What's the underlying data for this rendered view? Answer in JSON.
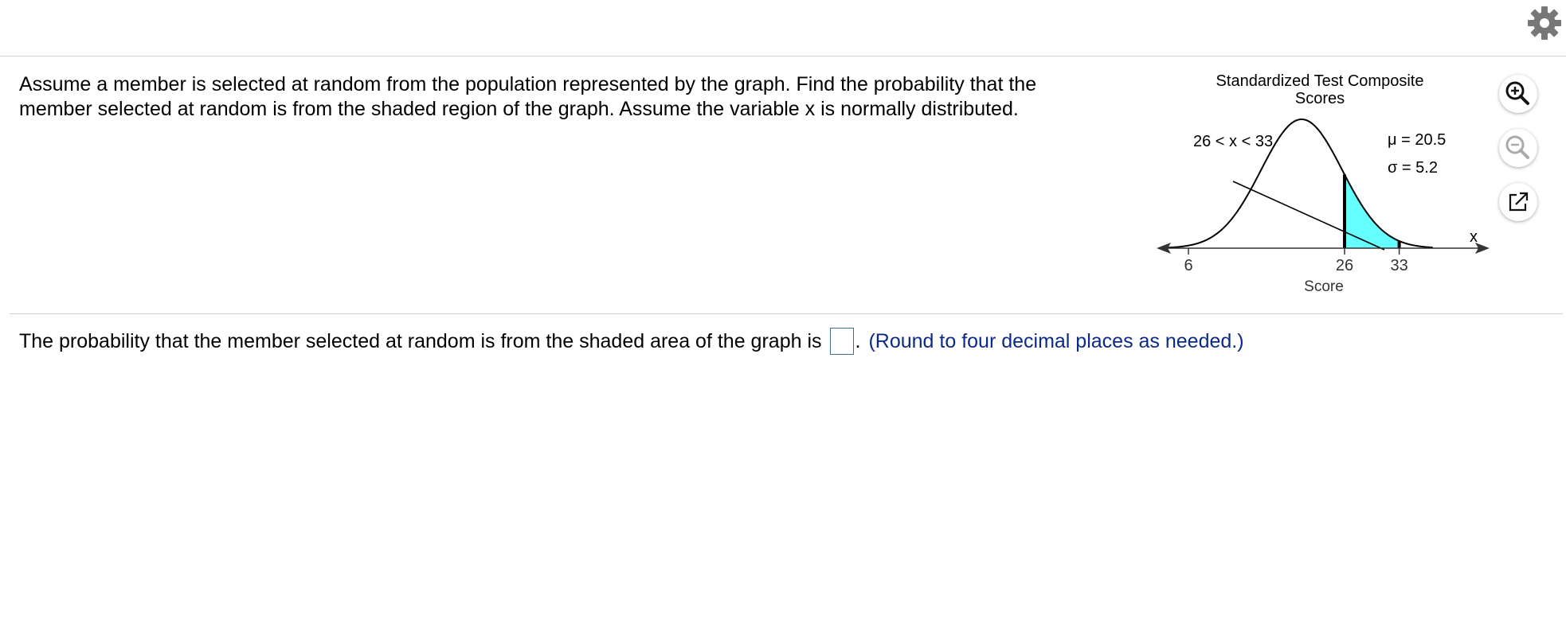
{
  "question": {
    "text": "Assume a member is selected at random from the population represented by the graph. Find the probability that the member selected at random is from the shaded region of the graph. Assume the variable x is normally distributed."
  },
  "graph": {
    "title_line1": "Standardized Test Composite",
    "title_line2": "Scores",
    "interval_label": "26 < x < 33",
    "mu_label": "μ = 20.5",
    "sigma_label": "σ = 5.2",
    "x_var": "x",
    "axis_label": "Score",
    "mu": 20.5,
    "sigma": 5.2,
    "shade_from": 26,
    "shade_to": 33,
    "ticks": [
      {
        "value": 6,
        "label": "6"
      },
      {
        "value": 26,
        "label": "26"
      },
      {
        "value": 33,
        "label": "33"
      }
    ],
    "shade_color": "#66ffff"
  },
  "answer": {
    "prefix": "The probability that the member selected at random is from the shaded area of the graph is",
    "suffix": ".",
    "hint": "(Round to four decimal places as needed.)"
  },
  "icons": [
    "gear-icon",
    "zoom-in-icon",
    "zoom-out-icon",
    "open-external-icon"
  ],
  "colors": {
    "hint": "#0b2a88",
    "border": "#cfcfcf"
  }
}
